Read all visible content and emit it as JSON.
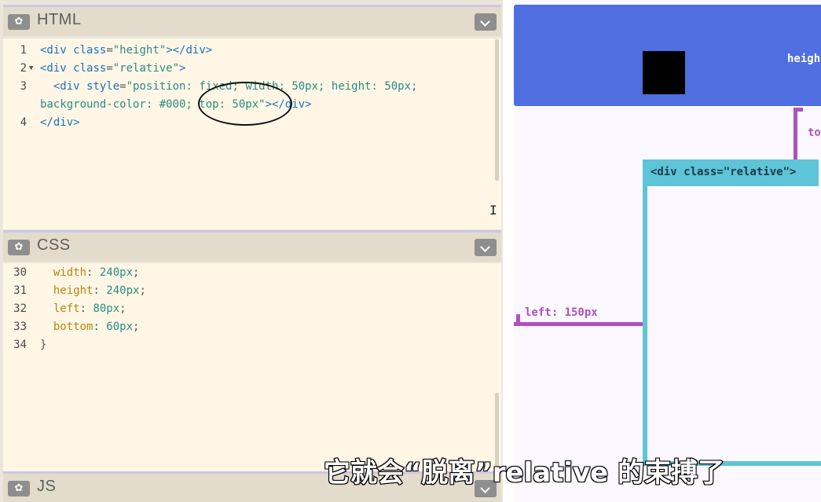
{
  "editor": {
    "html_panel": {
      "title": "HTML",
      "gear_icon": "gear-icon",
      "lines": [
        {
          "num": "1",
          "fold": "",
          "parts": [
            {
              "t": "<div ",
              "c": "tag"
            },
            {
              "t": "class",
              "c": "attr"
            },
            {
              "t": "=",
              "c": "punct"
            },
            {
              "t": "\"height\"",
              "c": "str"
            },
            {
              "t": "></div>",
              "c": "tag"
            }
          ]
        },
        {
          "num": "2",
          "fold": "▼",
          "parts": [
            {
              "t": "<div ",
              "c": "tag"
            },
            {
              "t": "class",
              "c": "attr"
            },
            {
              "t": "=",
              "c": "punct"
            },
            {
              "t": "\"relative\"",
              "c": "str"
            },
            {
              "t": ">",
              "c": "tag"
            }
          ]
        },
        {
          "num": "3",
          "fold": "",
          "parts": [
            {
              "t": "  <div ",
              "c": "tag"
            },
            {
              "t": "style",
              "c": "attr"
            },
            {
              "t": "=",
              "c": "punct"
            },
            {
              "t": "\"position: fixed; width: 50px; height: 50px;",
              "c": "str"
            }
          ]
        },
        {
          "num": "",
          "fold": "",
          "parts": [
            {
              "t": "background-color: #000; top: 50px\"",
              "c": "str"
            },
            {
              "t": "></div>",
              "c": "tag"
            }
          ]
        },
        {
          "num": "4",
          "fold": "",
          "parts": [
            {
              "t": "</div>",
              "c": "tag"
            }
          ]
        }
      ]
    },
    "css_panel": {
      "title": "CSS",
      "lines": [
        {
          "num": "30",
          "parts": [
            {
              "t": "  width",
              "c": "prop"
            },
            {
              "t": ": ",
              "c": "punct"
            },
            {
              "t": "240px",
              "c": "num"
            },
            {
              "t": ";",
              "c": "punct"
            }
          ]
        },
        {
          "num": "31",
          "parts": [
            {
              "t": "  height",
              "c": "prop"
            },
            {
              "t": ": ",
              "c": "punct"
            },
            {
              "t": "240px",
              "c": "num"
            },
            {
              "t": ";",
              "c": "punct"
            }
          ]
        },
        {
          "num": "32",
          "parts": [
            {
              "t": "  left",
              "c": "prop"
            },
            {
              "t": ": ",
              "c": "punct"
            },
            {
              "t": "80px",
              "c": "num"
            },
            {
              "t": ";",
              "c": "punct"
            }
          ]
        },
        {
          "num": "33",
          "parts": [
            {
              "t": "  bottom",
              "c": "prop"
            },
            {
              "t": ": ",
              "c": "punct"
            },
            {
              "t": "60px",
              "c": "num"
            },
            {
              "t": ";",
              "c": "punct"
            }
          ]
        },
        {
          "num": "34",
          "parts": [
            {
              "t": "}",
              "c": "punct"
            }
          ]
        }
      ]
    },
    "js_panel": {
      "title": "JS"
    }
  },
  "preview": {
    "height_label": "heigh",
    "top_label": "to",
    "left_label": "left: 150px",
    "relative_label": "<div class=\"relative\">"
  },
  "subtitle": "它就会“脱离”relative 的束搏了"
}
